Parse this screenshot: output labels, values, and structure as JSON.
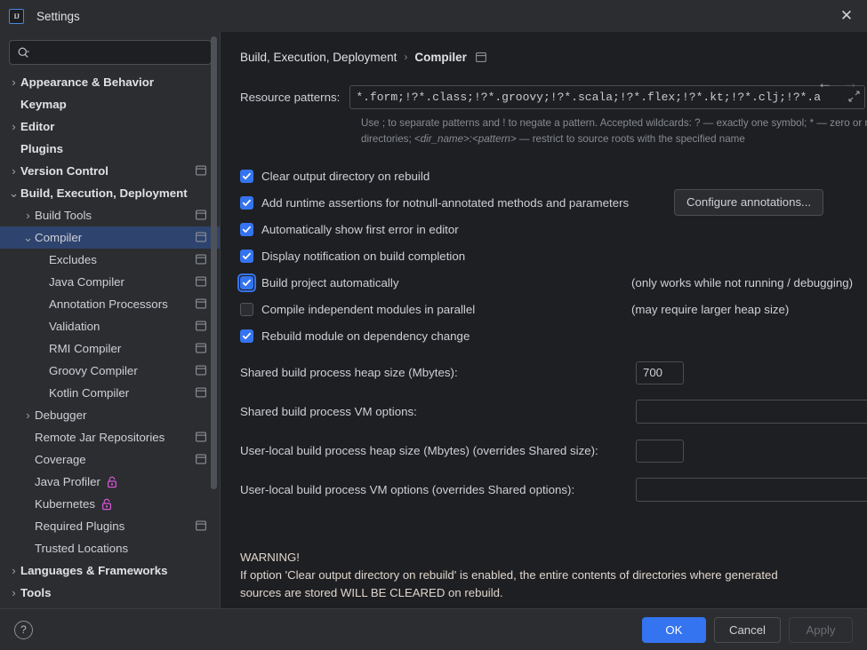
{
  "window": {
    "title": "Settings",
    "logo_text": "IJ",
    "close_icon": "close-icon"
  },
  "search": {
    "value": "",
    "placeholder": ""
  },
  "sidebar": {
    "items": [
      {
        "label": "Appearance & Behavior",
        "indent": 0,
        "arrow": "collapsed",
        "bold": true,
        "marker": false,
        "lock": false,
        "selected": false
      },
      {
        "label": "Keymap",
        "indent": 0,
        "arrow": "none",
        "bold": true,
        "marker": false,
        "lock": false,
        "selected": false
      },
      {
        "label": "Editor",
        "indent": 0,
        "arrow": "collapsed",
        "bold": true,
        "marker": false,
        "lock": false,
        "selected": false
      },
      {
        "label": "Plugins",
        "indent": 0,
        "arrow": "none",
        "bold": true,
        "marker": false,
        "lock": false,
        "selected": false
      },
      {
        "label": "Version Control",
        "indent": 0,
        "arrow": "collapsed",
        "bold": true,
        "marker": true,
        "lock": false,
        "selected": false
      },
      {
        "label": "Build, Execution, Deployment",
        "indent": 0,
        "arrow": "expanded",
        "bold": true,
        "marker": false,
        "lock": false,
        "selected": false
      },
      {
        "label": "Build Tools",
        "indent": 1,
        "arrow": "collapsed",
        "bold": false,
        "marker": true,
        "lock": false,
        "selected": false
      },
      {
        "label": "Compiler",
        "indent": 1,
        "arrow": "expanded",
        "bold": false,
        "marker": true,
        "lock": false,
        "selected": true
      },
      {
        "label": "Excludes",
        "indent": 2,
        "arrow": "none",
        "bold": false,
        "marker": true,
        "lock": false,
        "selected": false
      },
      {
        "label": "Java Compiler",
        "indent": 2,
        "arrow": "none",
        "bold": false,
        "marker": true,
        "lock": false,
        "selected": false
      },
      {
        "label": "Annotation Processors",
        "indent": 2,
        "arrow": "none",
        "bold": false,
        "marker": true,
        "lock": false,
        "selected": false
      },
      {
        "label": "Validation",
        "indent": 2,
        "arrow": "none",
        "bold": false,
        "marker": true,
        "lock": false,
        "selected": false
      },
      {
        "label": "RMI Compiler",
        "indent": 2,
        "arrow": "none",
        "bold": false,
        "marker": true,
        "lock": false,
        "selected": false
      },
      {
        "label": "Groovy Compiler",
        "indent": 2,
        "arrow": "none",
        "bold": false,
        "marker": true,
        "lock": false,
        "selected": false
      },
      {
        "label": "Kotlin Compiler",
        "indent": 2,
        "arrow": "none",
        "bold": false,
        "marker": true,
        "lock": false,
        "selected": false
      },
      {
        "label": "Debugger",
        "indent": 1,
        "arrow": "collapsed",
        "bold": false,
        "marker": false,
        "lock": false,
        "selected": false
      },
      {
        "label": "Remote Jar Repositories",
        "indent": 1,
        "arrow": "none",
        "bold": false,
        "marker": true,
        "lock": false,
        "selected": false
      },
      {
        "label": "Coverage",
        "indent": 1,
        "arrow": "none",
        "bold": false,
        "marker": true,
        "lock": false,
        "selected": false
      },
      {
        "label": "Java Profiler",
        "indent": 1,
        "arrow": "none",
        "bold": false,
        "marker": false,
        "lock": true,
        "selected": false
      },
      {
        "label": "Kubernetes",
        "indent": 1,
        "arrow": "none",
        "bold": false,
        "marker": false,
        "lock": true,
        "selected": false
      },
      {
        "label": "Required Plugins",
        "indent": 1,
        "arrow": "none",
        "bold": false,
        "marker": true,
        "lock": false,
        "selected": false
      },
      {
        "label": "Trusted Locations",
        "indent": 1,
        "arrow": "none",
        "bold": false,
        "marker": false,
        "lock": false,
        "selected": false
      },
      {
        "label": "Languages & Frameworks",
        "indent": 0,
        "arrow": "collapsed",
        "bold": true,
        "marker": false,
        "lock": false,
        "selected": false
      },
      {
        "label": "Tools",
        "indent": 0,
        "arrow": "collapsed",
        "bold": true,
        "marker": false,
        "lock": false,
        "selected": false
      }
    ]
  },
  "breadcrumb": {
    "root": "Build, Execution, Deployment",
    "separator": "›",
    "current": "Compiler",
    "marker_icon": "project-settings-marker-icon"
  },
  "nav": {
    "back_icon": "arrow-left-icon",
    "forward_icon": "arrow-right-icon"
  },
  "main": {
    "resource_patterns_label": "Resource patterns:",
    "resource_patterns_value": "*.form;!?*.class;!?*.groovy;!?*.scala;!?*.flex;!?*.kt;!?*.clj;!?*.a",
    "help_text_1": "Use ; to separate patterns and ! to negate a pattern. Accepted wildcards: ? — exactly one symbol; * — zero or",
    "help_text_2_a": "more symbols; / — path separator; /**/ — any number of directories; ",
    "help_text_2_i": "<dir_name>:<pattern>",
    "help_text_2_b": " — restrict to",
    "help_text_3": "source roots with the specified name",
    "checkboxes": [
      {
        "label": "Clear output directory on rebuild",
        "checked": true,
        "focused": false,
        "hint": ""
      },
      {
        "label": "Add runtime assertions for notnull-annotated methods and parameters",
        "checked": true,
        "focused": false,
        "hint": ""
      },
      {
        "label": "Automatically show first error in editor",
        "checked": true,
        "focused": false,
        "hint": ""
      },
      {
        "label": "Display notification on build completion",
        "checked": true,
        "focused": false,
        "hint": ""
      },
      {
        "label": "Build project automatically",
        "checked": true,
        "focused": true,
        "hint": "(only works while not running / debugging)"
      },
      {
        "label": "Compile independent modules in parallel",
        "checked": false,
        "focused": false,
        "hint": "(may require larger heap size)"
      },
      {
        "label": "Rebuild module on dependency change",
        "checked": true,
        "focused": false,
        "hint": ""
      }
    ],
    "configure_annotations_button": "Configure annotations...",
    "fields": [
      {
        "label": "Shared build process heap size (Mbytes):",
        "value": "700",
        "type": "small"
      },
      {
        "label": "Shared build process VM options:",
        "value": "",
        "type": "wide"
      },
      {
        "label": "User-local build process heap size (Mbytes) (overrides Shared size):",
        "value": "",
        "type": "small"
      },
      {
        "label": "User-local build process VM options (overrides Shared options):",
        "value": "",
        "type": "wide"
      }
    ],
    "warning_title": "WARNING!",
    "warning_line_1": "If option 'Clear output directory on rebuild' is enabled, the entire contents of directories where generated",
    "warning_line_2": "sources are stored WILL BE CLEARED on rebuild."
  },
  "footer": {
    "help_label": "?",
    "ok": "OK",
    "cancel": "Cancel",
    "apply": "Apply"
  },
  "colors": {
    "accent": "#3574f0",
    "selection": "#2e436e",
    "lock": "#d556d5",
    "warning_text": "#e0d5cc"
  }
}
